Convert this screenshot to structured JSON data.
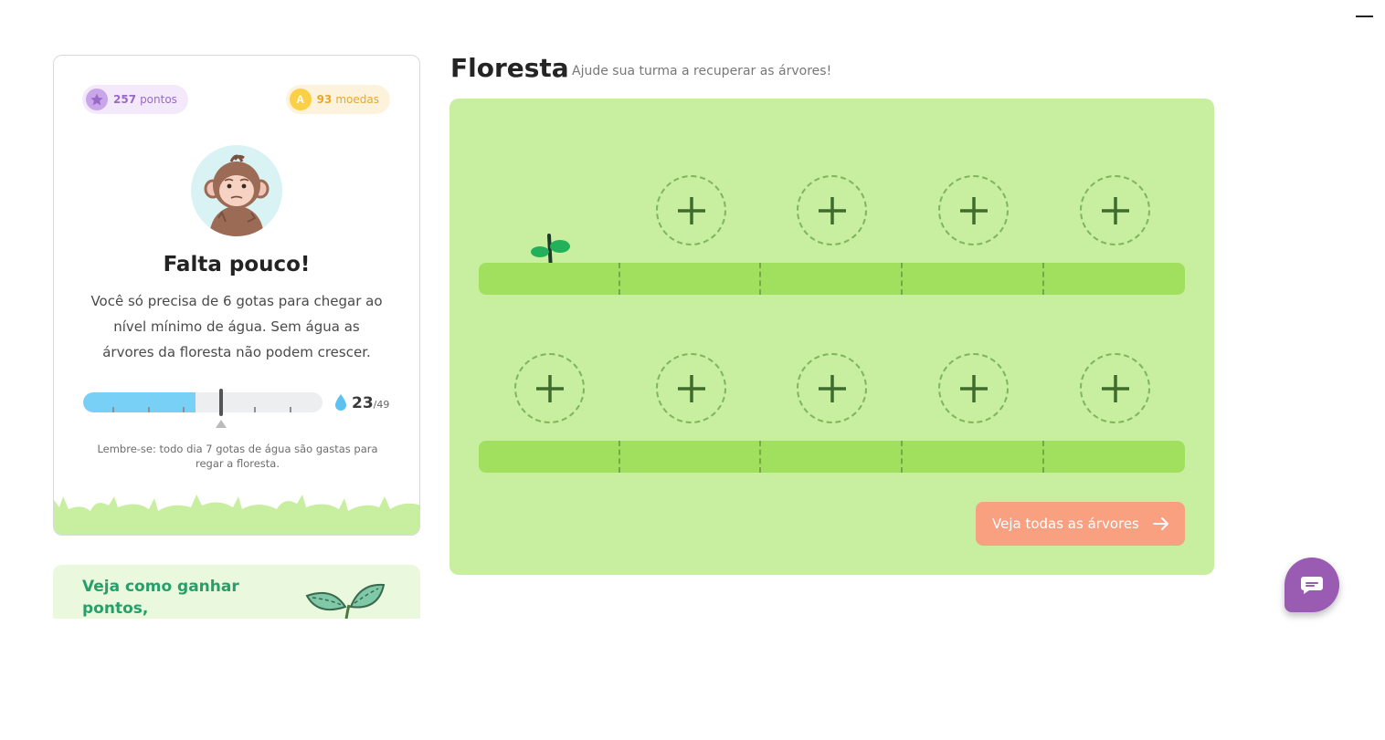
{
  "stats": {
    "points_value": "257",
    "points_label": "pontos",
    "coins_value": "93",
    "coins_label": "moedas",
    "coins_icon_letter": "A"
  },
  "status": {
    "title": "Falta pouco!",
    "text": "Você só precisa de 6 gotas para chegar ao nível mínimo de água. Sem água as árvores da floresta não podem crescer.",
    "water_current": "23",
    "water_max": "/49",
    "progress_fraction": 0.47,
    "minimum_fraction": 0.57,
    "reminder": "Lembre-se: todo dia 7 gotas de água são gastas para regar a floresta."
  },
  "promo": {
    "text": "Veja como ganhar pontos,"
  },
  "forest": {
    "title": "Floresta",
    "subtitle": "Ajude sua turma a recuperar as árvores!",
    "rows": [
      {
        "slots": [
          "sprout",
          "empty",
          "empty",
          "empty",
          "empty"
        ]
      },
      {
        "slots": [
          "empty",
          "empty",
          "empty",
          "empty",
          "empty"
        ]
      }
    ],
    "see_all_label": "Veja todas as árvores"
  },
  "icons": {
    "points": "star-icon",
    "coins": "coin-icon",
    "water": "drop-icon",
    "add": "plus-icon",
    "arrow": "arrow-right-icon",
    "chat": "chat-icon"
  },
  "colors": {
    "forest_bg": "#c8eea0",
    "ground": "#a1df5f",
    "button": "#f9a081",
    "chat": "#9a5bb3",
    "water_bar": "#79d0f7",
    "promo_text": "#26a06a"
  }
}
